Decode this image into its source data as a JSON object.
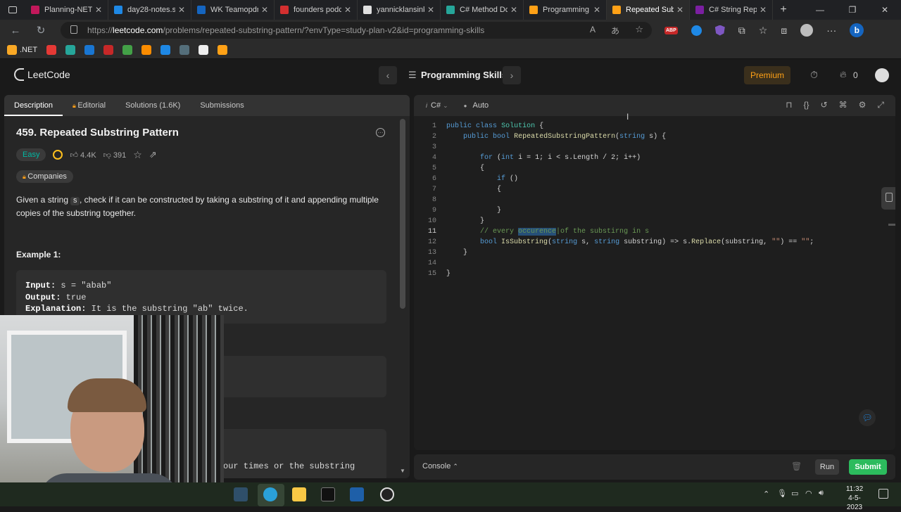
{
  "browser": {
    "tabs": [
      {
        "title": "Planning-NET",
        "color": "#c2185b"
      },
      {
        "title": "day28-notes.s",
        "color": "#1e88e5"
      },
      {
        "title": "WK Teamopdr",
        "color": "#1565c0"
      },
      {
        "title": "founders podc",
        "color": "#d32f2f"
      },
      {
        "title": "yannicklansink",
        "color": "#e0e0e0"
      },
      {
        "title": "C# Method Dc",
        "color": "#26a69a"
      },
      {
        "title": "Programming",
        "color": "#ffa116"
      },
      {
        "title": "Repeated Sub",
        "color": "#ffa116",
        "active": true
      },
      {
        "title": "C# String Rep",
        "color": "#7b1fa2"
      }
    ],
    "new_tab": "+",
    "url_domain": "leetcode.com",
    "url_prefix": "https://",
    "url_path": "/problems/repeated-substring-pattern/?envType=study-plan-v2&id=programming-skills",
    "bookmarks": [
      {
        "label": ".NET",
        "color": "#f9a825"
      },
      {
        "label": "",
        "color": "#e53935"
      },
      {
        "label": "",
        "color": "#26a69a"
      },
      {
        "label": "",
        "color": "#1976d2"
      },
      {
        "label": "",
        "color": "#c62828"
      },
      {
        "label": "",
        "color": "#43a047"
      },
      {
        "label": "",
        "color": "#fb8c00"
      },
      {
        "label": "",
        "color": "#1e88e5"
      },
      {
        "label": "",
        "color": "#546e7a"
      },
      {
        "label": "",
        "color": "#eeeeee"
      },
      {
        "label": "",
        "color": "#ffa116"
      }
    ],
    "ext_abp": "ABP"
  },
  "lc_header": {
    "logo": "LeetCode",
    "study_plan": "Programming Skills",
    "premium": "Premium",
    "streak": "0"
  },
  "description": {
    "tabs": [
      "Description",
      "Editorial",
      "Solutions (1.6K)",
      "Submissions"
    ],
    "title": "459. Repeated Substring Pattern",
    "difficulty": "Easy",
    "likes": "4.4K",
    "dislikes": "391",
    "companies": "Companies",
    "body_a": "Given a string ",
    "body_code": "s",
    "body_b": ", check if it can be constructed by taking a substring of it and appending multiple copies of the substring together.",
    "example_heading": "Example 1:",
    "ex_input_label": "Input:",
    "ex_input_value": " s = \"abab\"",
    "ex_output_label": "Output:",
    "ex_output_value": " true",
    "ex_expl_label": "Explanation:",
    "ex_expl_value": " It is the substring \"ab\" twice.",
    "ex3_partial": "our times or the substring"
  },
  "editor": {
    "language": "C#",
    "mode": "Auto",
    "current_line": 11,
    "line_numbers": [
      "1",
      "2",
      "3",
      "4",
      "5",
      "6",
      "7",
      "8",
      "9",
      "10",
      "11",
      "12",
      "13",
      "14",
      "15"
    ]
  },
  "console": {
    "label": "Console",
    "run": "Run",
    "submit": "Submit"
  },
  "taskbar": {
    "time": "11:32",
    "date": "4-5-2023"
  }
}
